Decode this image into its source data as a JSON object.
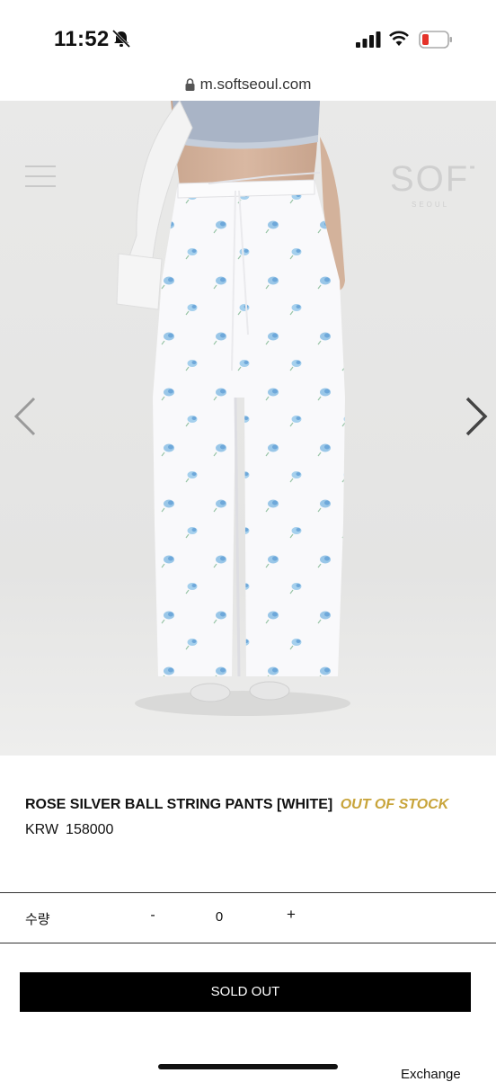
{
  "status_bar": {
    "time": "11:52"
  },
  "url_bar": {
    "domain": "m.softseoul.com"
  },
  "header": {
    "brand_main": "SOFT",
    "brand_sub": "SEOUL"
  },
  "product": {
    "title": "ROSE SILVER BALL STRING PANTS [WHITE]",
    "stock_status": "OUT OF STOCK",
    "currency": "KRW",
    "price": "158000"
  },
  "quantity": {
    "label": "수량",
    "minus": "-",
    "value": "0",
    "plus": "+"
  },
  "actions": {
    "sold_out_label": "SOLD OUT"
  },
  "footer": {
    "exchange_label": "Exchange"
  },
  "colors": {
    "accent_gold": "#c8a43a",
    "button_bg": "#000000",
    "hero_bg": "#ececec",
    "print_blue": "#8fc1e6"
  }
}
